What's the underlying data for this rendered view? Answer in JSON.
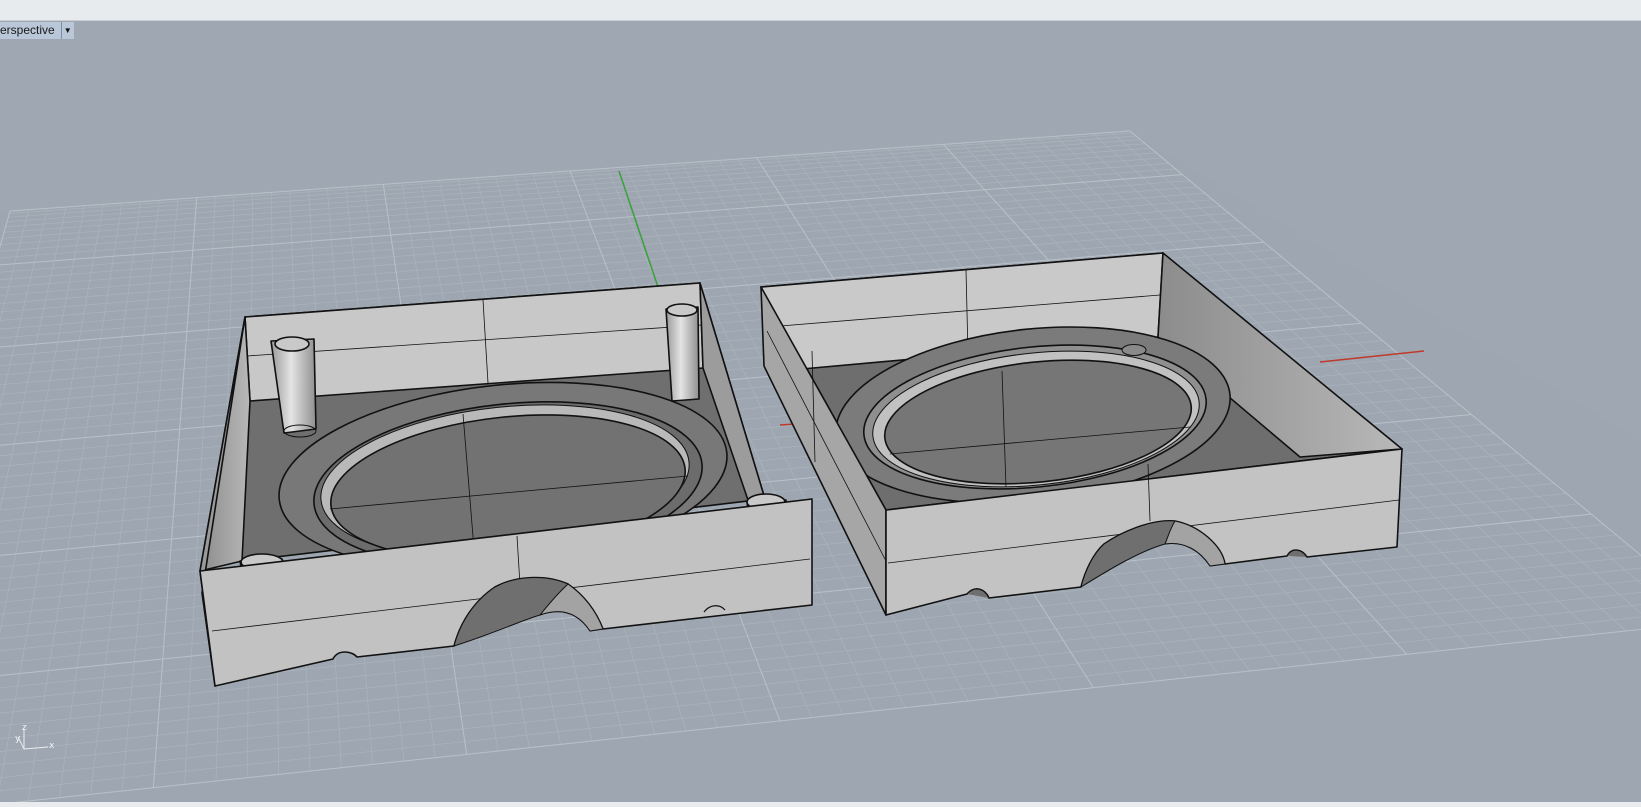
{
  "viewport": {
    "title": "erspective",
    "dropdown_icon": "triangle-down-icon"
  },
  "axis_gizmo": {
    "x_label": "x",
    "y_label": "y",
    "z_label": "z"
  },
  "colors": {
    "viewport_background": "#9fa8b2",
    "grid_minor": "#adb5be",
    "grid_major": "#c3c9d0",
    "x_axis": "#c0392b",
    "y_axis": "#3a9a3a",
    "model_face": "#bfbfbf",
    "model_edge": "#111111"
  }
}
